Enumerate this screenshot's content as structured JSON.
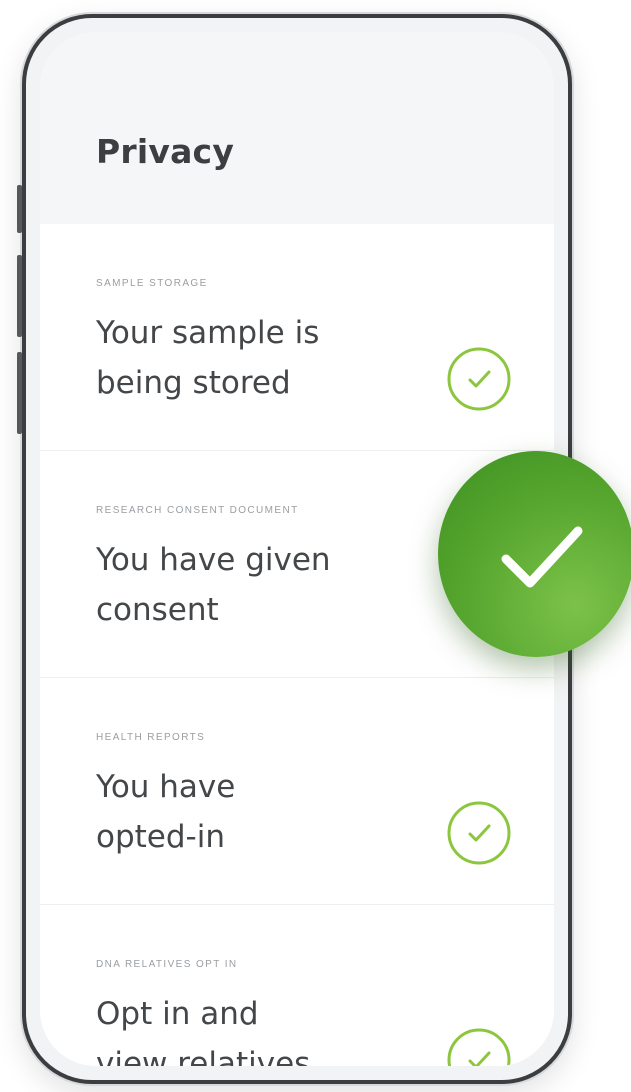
{
  "screen": {
    "title": "Privacy"
  },
  "items": [
    {
      "label": "SAMPLE STORAGE",
      "text_line1": "Your sample is",
      "text_line2": "being stored",
      "status": "checked"
    },
    {
      "label": "RESEARCH CONSENT DOCUMENT",
      "text_line1": "You have given",
      "text_line2": "consent",
      "status": "checked"
    },
    {
      "label": "HEALTH REPORTS",
      "text_line1": "You have",
      "text_line2": "opted-in",
      "status": "checked"
    },
    {
      "label": "DNA RELATIVES OPT IN",
      "text_line1": "Opt in and",
      "text_line2": "view relatives",
      "status": "checked"
    }
  ],
  "colors": {
    "accent_green": "#7cc24a",
    "badge_green": "#55a52e",
    "text_dark": "#44474a",
    "label_gray": "#9a9ea2"
  },
  "icons": {
    "row_status": "check-circle-outline-icon",
    "feature_badge": "check-circle-filled-icon"
  }
}
